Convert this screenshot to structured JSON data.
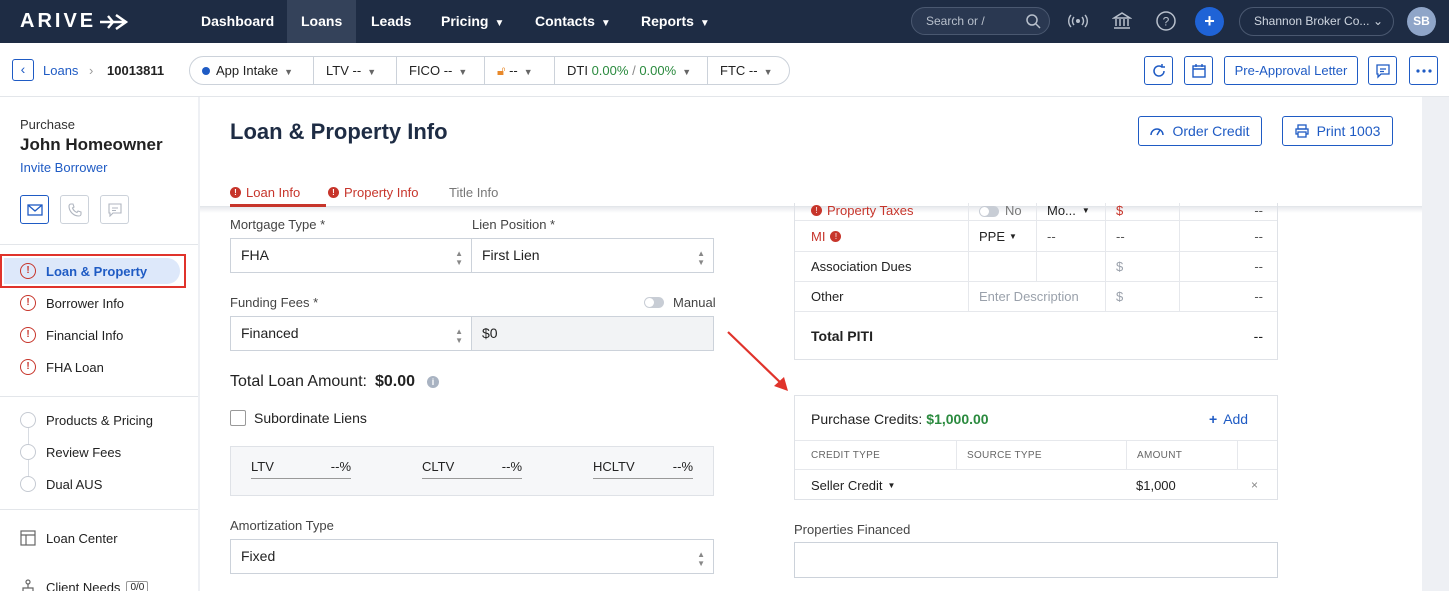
{
  "topnav": {
    "logo": "ARIVE",
    "items": [
      {
        "label": "Dashboard",
        "has_menu": false,
        "active": false
      },
      {
        "label": "Loans",
        "has_menu": false,
        "active": true
      },
      {
        "label": "Leads",
        "has_menu": false,
        "active": false
      },
      {
        "label": "Pricing",
        "has_menu": true,
        "active": false
      },
      {
        "label": "Contacts",
        "has_menu": true,
        "active": false
      },
      {
        "label": "Reports",
        "has_menu": true,
        "active": false
      }
    ],
    "search_placeholder": "Search or /",
    "broker": "Shannon Broker Co...",
    "avatar": "SB"
  },
  "subbar": {
    "crumb_loans": "Loans",
    "crumb_sep": "›",
    "loan_id": "10013811",
    "pills": {
      "app_intake": "App Intake",
      "ltv_label": "LTV",
      "ltv_value": "--",
      "fico_label": "FICO",
      "fico_value": "--",
      "lock_value": "--",
      "dti_label": "DTI",
      "dti_value_1": "0.00%",
      "dti_sep": "/",
      "dti_value_2": "0.00%",
      "ftc_label": "FTC",
      "ftc_value": "--"
    },
    "preapproval_label": "Pre-Approval Letter"
  },
  "sidebar": {
    "loan_purpose": "Purchase",
    "borrower_name": "John Homeowner",
    "invite_label": "Invite Borrower",
    "items": [
      {
        "label": "Loan & Property",
        "status": "error"
      },
      {
        "label": "Borrower Info",
        "status": "error"
      },
      {
        "label": "Financial Info",
        "status": "error"
      },
      {
        "label": "FHA Loan",
        "status": "error"
      },
      {
        "label": "Products & Pricing",
        "status": "none"
      },
      {
        "label": "Review Fees",
        "status": "none"
      },
      {
        "label": "Dual AUS",
        "status": "none"
      },
      {
        "label": "Loan Center",
        "status": "none"
      },
      {
        "label": "Client Needs",
        "status": "none"
      }
    ],
    "client_needs_badge": "0/0"
  },
  "main": {
    "title": "Loan & Property Info",
    "order_credit_label": "Order Credit",
    "print_label": "Print 1003",
    "tabs": [
      "Loan Info",
      "Property Info",
      "Title Info"
    ],
    "mortgage_type_label": "Mortgage Type *",
    "mortgage_type_value": "FHA",
    "lien_position_label": "Lien Position *",
    "lien_position_value": "First Lien",
    "funding_fees_label": "Funding Fees *",
    "funding_fees_value": "Financed",
    "funding_fees_amount": "$0",
    "manual_label": "Manual",
    "total_loan_label": "Total Loan Amount:",
    "total_loan_value": "$0.00",
    "subordinate_label": "Subordinate Liens",
    "ratios": [
      {
        "label": "LTV",
        "value": "--%"
      },
      {
        "label": "CLTV",
        "value": "--%"
      },
      {
        "label": "HCLTV",
        "value": "--%"
      }
    ],
    "amortization_label": "Amortization Type",
    "amortization_value": "Fixed"
  },
  "piti": {
    "property_taxes": {
      "label": "Property Taxes",
      "toggle": "No",
      "freq": "Mo...",
      "currency": "$",
      "amount": "--"
    },
    "mi": {
      "label": "MI",
      "type": "PPE",
      "col3": "--",
      "col4": "--",
      "amount": "--"
    },
    "association": {
      "label": "Association Dues",
      "currency": "$",
      "amount": "--"
    },
    "other": {
      "label": "Other",
      "placeholder": "Enter Description",
      "currency": "$",
      "amount": "--"
    },
    "total": {
      "label": "Total PITI",
      "amount": "--"
    }
  },
  "purchase_credits": {
    "title": "Purchase Credits:",
    "total": "$1,000.00",
    "add_label": "Add",
    "headers": [
      "CREDIT TYPE",
      "SOURCE TYPE",
      "AMOUNT"
    ],
    "rows": [
      {
        "credit_type": "Seller Credit",
        "source_type": "",
        "amount": "$1,000"
      }
    ]
  },
  "properties_financed_label": "Properties Financed",
  "colors": {
    "nav_bg": "#1e2c44",
    "accent": "#1f5bc4",
    "error": "#c7352b",
    "success": "#2a8a3e",
    "highlight_box": "#e0332b"
  }
}
